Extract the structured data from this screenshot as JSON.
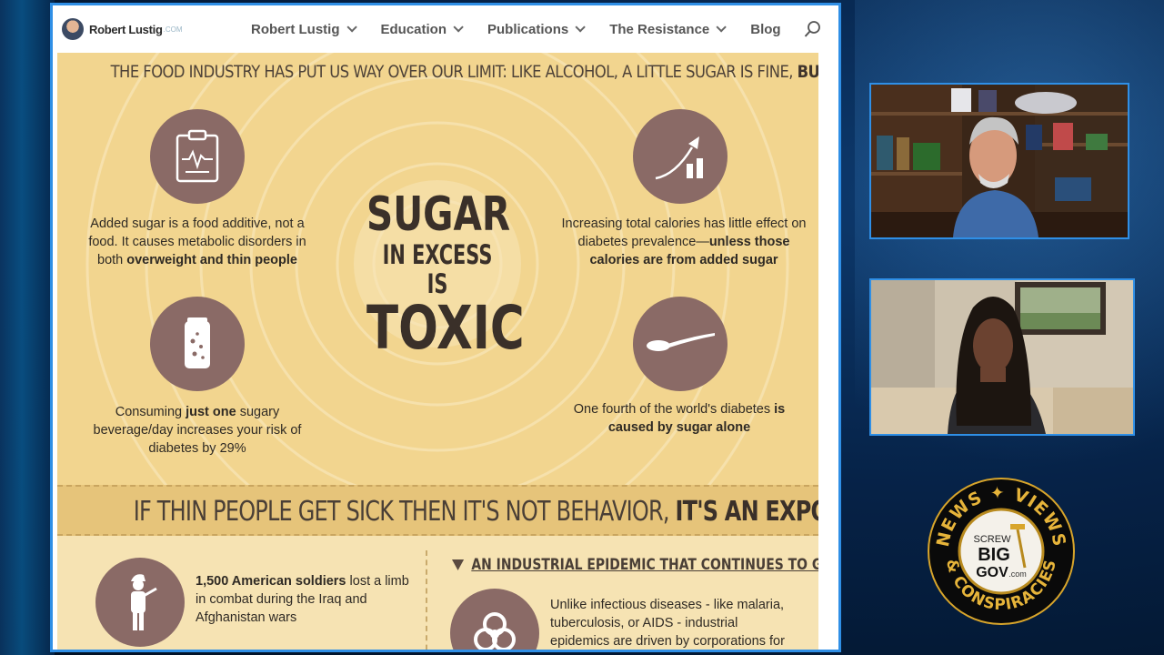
{
  "site": {
    "brand_name": "Robert Lustig",
    "brand_tld": ".COM",
    "nav": [
      {
        "label": "Robert Lustig",
        "dropdown": true
      },
      {
        "label": "Education",
        "dropdown": true
      },
      {
        "label": "Publications",
        "dropdown": true
      },
      {
        "label": "The Resistance",
        "dropdown": true
      },
      {
        "label": "Blog",
        "dropdown": false
      }
    ]
  },
  "infographic": {
    "headline_regular": "THE FOOD INDUSTRY HAS PUT US WAY OVER OUR LIMIT: LIKE ALCOHOL, A LITTLE SUGAR IS FINE, ",
    "headline_bold": "BUT A LOT IS NOT",
    "center_title": {
      "line1": "SUGAR",
      "line2": "IN EXCESS IS",
      "line3": "TOXIC"
    },
    "facts": {
      "top_left": {
        "pre": "Added sugar is a food additive, not a food. It causes metabolic disorders in both ",
        "bold": "overweight and thin people",
        "post": ""
      },
      "top_right": {
        "pre": "Increasing total calories has little effect on diabetes prevalence—",
        "bold": "unless those calories are from added sugar",
        "post": ""
      },
      "bottom_left": {
        "pre": "Consuming ",
        "bold": "just one",
        "post": " sugary beverage/day increases your risk of diabetes by 29%"
      },
      "bottom_right": {
        "pre": "One fourth of the world's diabetes ",
        "bold": "is caused by sugar alone",
        "post": ""
      }
    },
    "band_regular": "IF THIN PEOPLE GET SICK THEN IT'S NOT BEHAVIOR, ",
    "band_bold": "IT'S AN EXPOSURE",
    "soldiers": {
      "bold": "1,500 American soldiers",
      "rest": " lost a limb in combat during the Iraq and Afghanistan wars"
    },
    "epidemic_heading": "AN INDUSTRIAL EPIDEMIC THAT CONTINUES TO GROW",
    "epidemic_text": "Unlike infectious diseases - like malaria, tuberculosis, or AIDS - industrial epidemics are driven by corporations for profit."
  },
  "icons": {
    "clipboard": "clipboard-ecg-icon",
    "chart": "rising-chart-icon",
    "soda": "soda-can-icon",
    "spoon": "spoon-icon",
    "soldier": "soldier-icon",
    "biohazard": "biohazard-icon"
  },
  "logo": {
    "top": "NEWS ✦ VIEWS",
    "bottom": "& CONSPIRACIES",
    "center_1": "SCREW",
    "center_2": "BIG",
    "center_3": "GOV",
    "center_tld": ".com"
  },
  "colors": {
    "frame": "#2f8fe6",
    "icon_circle": "#8a6a66",
    "poster": "#f1d38e"
  }
}
